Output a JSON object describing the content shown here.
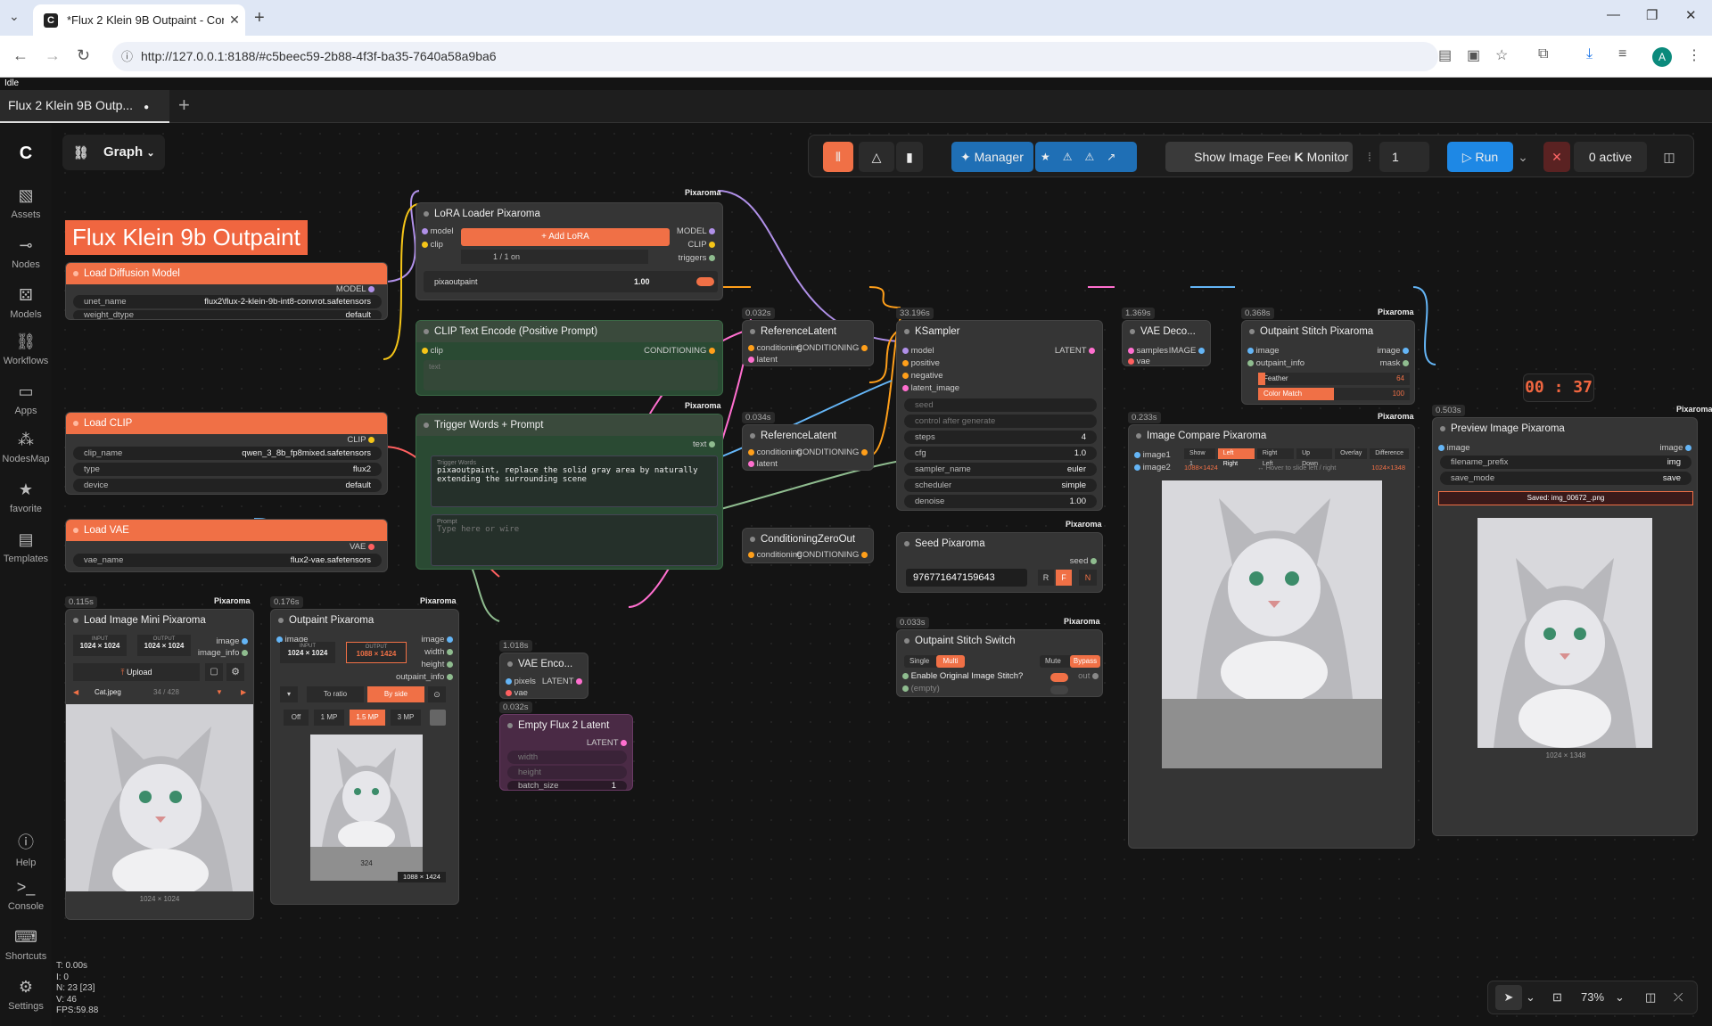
{
  "browser": {
    "tab_title": "*Flux 2 Klein 9B Outpaint - Com",
    "url": "http://127.0.0.1:8188/#c5beec59-2b88-4f3f-ba35-7640a58a9ba6",
    "avatar_letter": "A"
  },
  "app": {
    "status": "Idle",
    "workflow_tab": "Flux 2 Klein 9B Outp...",
    "graph_label": "Graph",
    "sidebar": [
      {
        "label": "Assets",
        "icon": "assets-icon"
      },
      {
        "label": "Nodes",
        "icon": "nodes-icon"
      },
      {
        "label": "Models",
        "icon": "models-icon"
      },
      {
        "label": "Workflows",
        "icon": "workflows-icon"
      },
      {
        "label": "Apps",
        "icon": "apps-icon"
      },
      {
        "label": "NodesMap",
        "icon": "nodesmap-icon"
      },
      {
        "label": "favorite",
        "icon": "star-icon"
      },
      {
        "label": "Templates",
        "icon": "templates-icon"
      },
      {
        "label": "Help",
        "icon": "help-icon"
      },
      {
        "label": "Console",
        "icon": "console-icon"
      },
      {
        "label": "Shortcuts",
        "icon": "keyboard-icon"
      },
      {
        "label": "Settings",
        "icon": "gear-icon"
      }
    ],
    "toolbar": {
      "manager": "Manager",
      "show_feed": "Show Image Feed",
      "monitor": "Monitor",
      "monitor_k": "K",
      "queue_count": "1",
      "run": "Run",
      "active": "0 active"
    },
    "stats": [
      "T: 0.00s",
      "I: 0",
      "N: 23 [23]",
      "V: 46",
      "FPS:59.88"
    ],
    "zoom": "73%",
    "timer": "00 : 37"
  },
  "group_title": "Flux Klein 9b Outpaint",
  "nodes": {
    "load_diffusion": {
      "title": "Load Diffusion Model",
      "out": "MODEL",
      "w1_label": "unet_name",
      "w1_val": "flux2\\flux-2-klein-9b-int8-convrot.safetensors",
      "w2_label": "weight_dtype",
      "w2_val": "default"
    },
    "load_clip": {
      "title": "Load CLIP",
      "out": "CLIP",
      "w1_label": "clip_name",
      "w1_val": "qwen_3_8b_fp8mixed.safetensors",
      "w2_label": "type",
      "w2_val": "flux2",
      "w3_label": "device",
      "w3_val": "default"
    },
    "load_vae": {
      "title": "Load VAE",
      "out": "VAE",
      "w1_label": "vae_name",
      "w1_val": "flux2-vae.safetensors"
    },
    "lora": {
      "title": "LoRA Loader Pixaroma",
      "brand": "Pixaroma",
      "in1": "model",
      "in2": "clip",
      "out1": "MODEL",
      "out2": "CLIP",
      "out3": "triggers",
      "add": "+ Add LoRA",
      "count": "1 / 1 on",
      "lora_name": "pixaoutpaint",
      "strength": "1.00"
    },
    "clip_pos": {
      "title": "CLIP Text Encode (Positive Prompt)",
      "in": "clip",
      "out": "CONDITIONING",
      "placeholder": "text"
    },
    "trigger": {
      "title": "Trigger Words + Prompt",
      "brand": "Pixaroma",
      "out": "text",
      "tw_label": "Trigger Words",
      "tw_text": "pixaoutpaint, replace the solid gray area by naturally extending the surrounding scene",
      "p_label": "Prompt",
      "p_placeholder": "Type here or wire"
    },
    "ref1": {
      "time": "0.032s",
      "title": "ReferenceLatent",
      "in1": "conditioning",
      "in2": "latent",
      "out": "CONDITIONING"
    },
    "ref2": {
      "time": "0.034s",
      "title": "ReferenceLatent",
      "in1": "conditioning",
      "in2": "latent",
      "out": "CONDITIONING"
    },
    "czero": {
      "title": "ConditioningZeroOut",
      "in": "conditioning",
      "out": "CONDITIONING"
    },
    "ksampler": {
      "time": "33.196s",
      "title": "KSampler",
      "in": [
        "model",
        "positive",
        "negative",
        "latent_image"
      ],
      "out": "LATENT",
      "seed": "seed",
      "control": "control after generate",
      "widgets": [
        [
          "steps",
          "4"
        ],
        [
          "cfg",
          "1.0"
        ],
        [
          "sampler_name",
          "euler"
        ],
        [
          "scheduler",
          "simple"
        ],
        [
          "denoise",
          "1.00"
        ]
      ]
    },
    "vaedec": {
      "time": "1.369s",
      "title": "VAE Deco...",
      "in1": "samples",
      "in2": "vae",
      "out": "IMAGE"
    },
    "stitch": {
      "time": "0.368s",
      "title": "Outpaint Stitch Pixaroma",
      "brand": "Pixaroma",
      "in1": "image",
      "in2": "outpaint_info",
      "out1": "image",
      "out2": "mask",
      "feather": "Feather",
      "feather_v": "64",
      "color": "Color Match",
      "color_v": "100"
    },
    "seed": {
      "title": "Seed Pixaroma",
      "brand": "Pixaroma",
      "out": "seed",
      "value": "976771647159643",
      "r": "R",
      "f": "F",
      "n": "N"
    },
    "switch": {
      "time": "0.033s",
      "title": "Outpaint Stitch Switch",
      "brand": "Pixaroma",
      "single": "Single",
      "multi": "Multi",
      "mute": "Mute",
      "bypass": "Bypass",
      "enable": "Enable Original Image Stitch?",
      "empty": "(empty)",
      "out": "out"
    },
    "compare": {
      "time": "0.233s",
      "title": "Image Compare Pixaroma",
      "brand": "Pixaroma",
      "in1": "image1",
      "in2": "image2",
      "modes": [
        "Show 1",
        "Left Right",
        "Right Left",
        "Up Down",
        "Overlay",
        "Difference"
      ],
      "dim1": "1088×1424",
      "hint": "↔ Hover to slide left / right",
      "dim2": "1024×1348"
    },
    "preview": {
      "time": "0.503s",
      "title": "Preview Image Pixaroma",
      "brand": "Pixaroma",
      "in": "image",
      "out": "image",
      "w1_label": "filename_prefix",
      "w1_val": "img",
      "w2_label": "save_mode",
      "w2_val": "save",
      "saved": "Saved: img_00672_.png",
      "dims": "1024 × 1348"
    },
    "loadimg": {
      "time": "0.115s",
      "title": "Load Image Mini Pixaroma",
      "brand": "Pixaroma",
      "input_l": "INPUT",
      "input_v": "1024 × 1024",
      "output_l": "OUTPUT",
      "output_v": "1024 × 1024",
      "out1": "image",
      "out2": "image_info",
      "upload": "Upload",
      "file": "Cat.jpeg",
      "count": "34 / 428",
      "dims": "1024 × 1024"
    },
    "outpaint": {
      "time": "0.176s",
      "title": "Outpaint Pixaroma",
      "brand": "Pixaroma",
      "in": "image",
      "out": [
        "image",
        "width",
        "height",
        "outpaint_info"
      ],
      "input_l": "INPUT",
      "input_v": "1024 × 1024",
      "output_l": "OUTPUT",
      "output_v": "1088 × 1424",
      "to_ratio": "To ratio",
      "by_side": "By side",
      "sizes": [
        "Off",
        "1 MP",
        "1.5 MP",
        "3 MP"
      ],
      "pad": "324",
      "dims": "1088 × 1424"
    },
    "vaeenc": {
      "time": "1.018s",
      "title": "VAE Enco...",
      "in1": "pixels",
      "in2": "vae",
      "out": "LATENT"
    },
    "empty": {
      "time": "0.032s",
      "title": "Empty Flux 2 Latent",
      "out": "LATENT",
      "w1": "width",
      "w2": "height",
      "w3_label": "batch_size",
      "w3_val": "1"
    }
  },
  "colors": {
    "accent": "#f07046",
    "run": "#1e88e5",
    "manager": "#1f6fb5"
  }
}
